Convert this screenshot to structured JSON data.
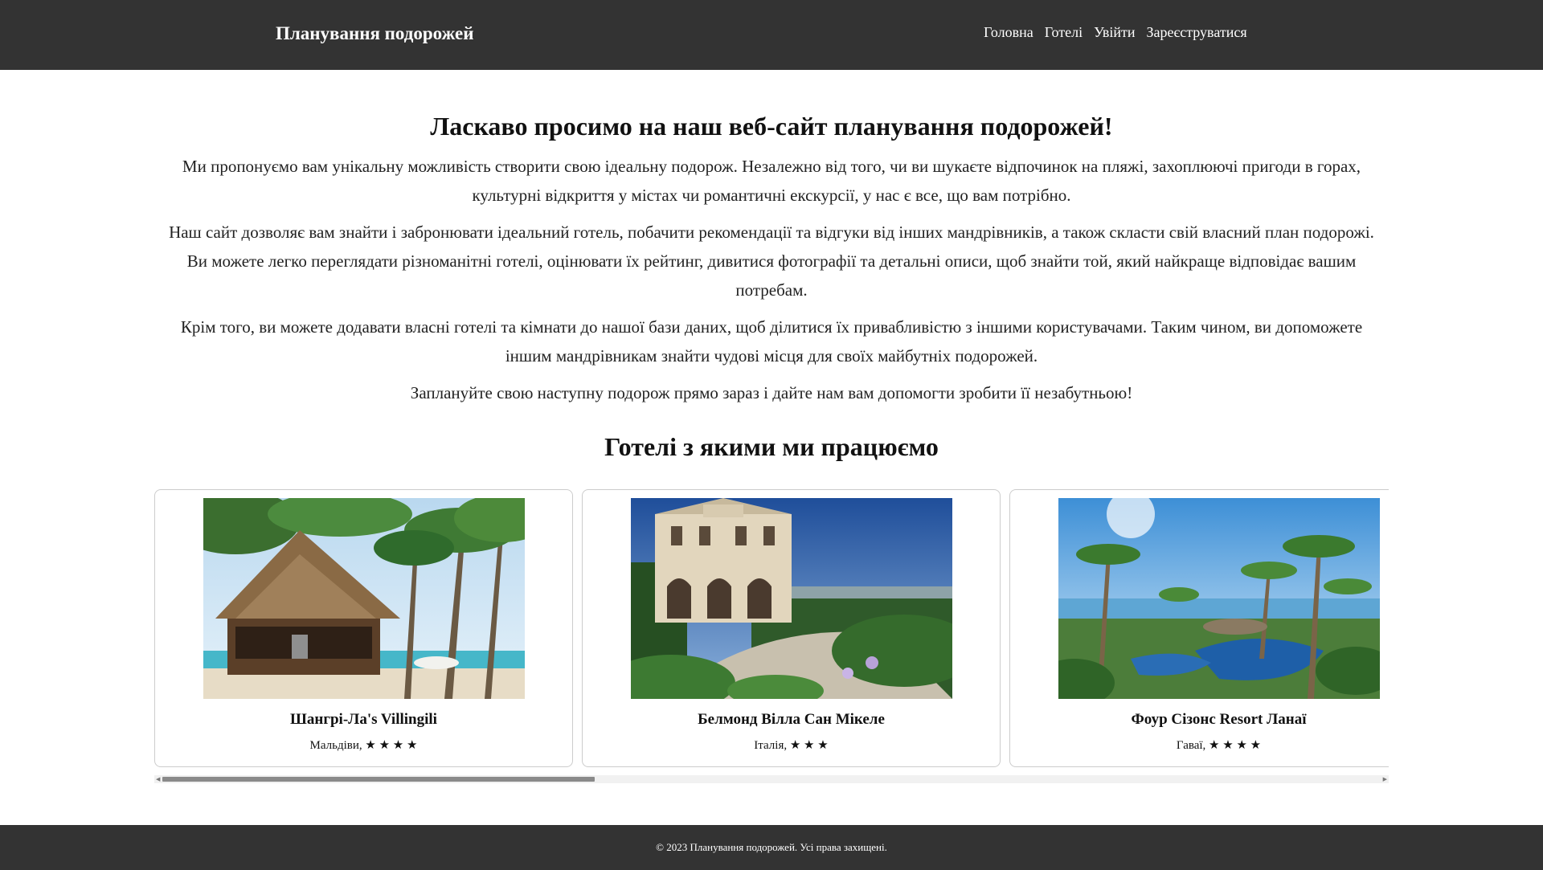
{
  "header": {
    "brand": "Планування подорожей",
    "nav": [
      "Головна",
      "Готелі",
      "Увійти",
      "Зареєструватися"
    ]
  },
  "main": {
    "title": "Ласкаво просимо на наш веб-сайт планування подорожей!",
    "paragraphs": [
      "Ми пропонуємо вам унікальну можливість створити свою ідеальну подорож. Незалежно від того, чи ви шукаєте відпочинок на пляжі, захоплюючі пригоди в горах, культурні відкриття у містах чи романтичні екскурсії, у нас є все, що вам потрібно.",
      "Наш сайт дозволяє вам знайти і забронювати ідеальний готель, побачити рекомендації та відгуки від інших мандрівників, а також скласти свій власний план подорожі. Ви можете легко переглядати різноманітні готелі, оцінювати їх рейтинг, дивитися фотографії та детальні описи, щоб знайти той, який найкраще відповідає вашим потребам.",
      "Крім того, ви можете додавати власні готелі та кімнати до нашої бази даних, щоб ділитися їх привабливістю з іншими користувачами. Таким чином, ви допоможете іншим мандрівникам знайти чудові місця для своїх майбутніх подорожей.",
      "Заплануйте свою наступну подорож прямо зараз і дайте нам вам допомогти зробити її незабутньою!"
    ]
  },
  "hotels": {
    "title": "Готелі з якими ми працюємо",
    "items": [
      {
        "name": "Шангрі-Ла's Villingili",
        "meta": "Мальдіви, ★ ★ ★ ★",
        "image": "beach-gazebo"
      },
      {
        "name": "Белмонд Вілла Сан Мікеле",
        "meta": "Італія, ★ ★ ★",
        "image": "villa-garden"
      },
      {
        "name": "Фоур Сізонс Resort Ланаї",
        "meta": "Гаваї, ★ ★ ★ ★",
        "image": "palm-resort-pool"
      }
    ]
  },
  "scroll": {
    "position": 0
  },
  "footer": {
    "text": "© 2023 Планування подорожей. Усі права захищені."
  },
  "colors": {
    "header_bg": "#333333",
    "footer_bg": "#333333",
    "card_border": "#cccccc"
  }
}
